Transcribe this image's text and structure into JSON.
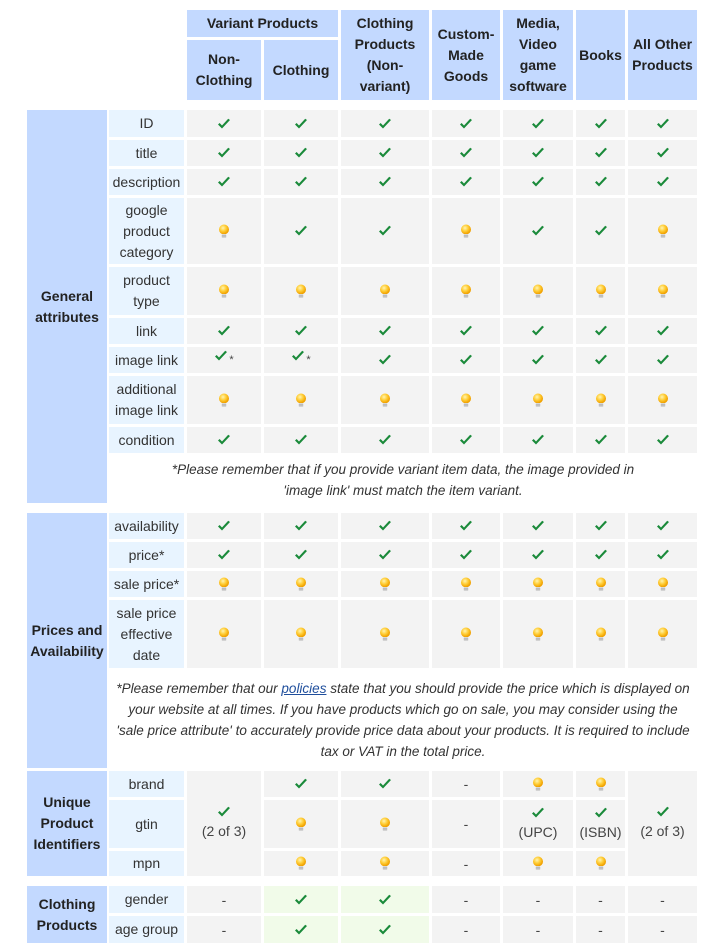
{
  "header": {
    "variant_group": "Variant Products",
    "columns": [
      {
        "key": "non_clothing",
        "label": "Non-\nClothing"
      },
      {
        "key": "clothing",
        "label": "Clothing"
      },
      {
        "key": "clothing_nonvariant",
        "label": "Clothing\nProducts\n(Non-\nvariant)"
      },
      {
        "key": "custom",
        "label": "Custom-\nMade\nGoods"
      },
      {
        "key": "media",
        "label": "Media,\nVideo\ngame\nsoftware"
      },
      {
        "key": "books",
        "label": "Books"
      },
      {
        "key": "other",
        "label": "All Other\nProducts"
      }
    ]
  },
  "legend_icons": {
    "required": "check-icon",
    "recommended": "lightbulb-icon",
    "not_applicable": "-"
  },
  "colors": {
    "header_bg": "#c3d9ff",
    "attr_bg": "#e8f4ff",
    "cell_bg": "#f3f3f3",
    "highlight_bg": "#f1fbe9",
    "check": "#1a8a3a",
    "bulb": "#f5b400",
    "link": "#1f4e9c"
  },
  "sections": [
    {
      "name": "General\nattributes",
      "rows": [
        {
          "attr": "ID",
          "cells": [
            "check",
            "check",
            "check",
            "check",
            "check",
            "check",
            "check"
          ]
        },
        {
          "attr": "title",
          "cells": [
            "check",
            "check",
            "check",
            "check",
            "check",
            "check",
            "check"
          ]
        },
        {
          "attr": "description",
          "cells": [
            "check",
            "check",
            "check",
            "check",
            "check",
            "check",
            "check"
          ]
        },
        {
          "attr": "google\nproduct\ncategory",
          "cells": [
            "bulb",
            "check",
            "check",
            "bulb",
            "check",
            "check",
            "bulb"
          ]
        },
        {
          "attr": "product\ntype",
          "cells": [
            "bulb",
            "bulb",
            "bulb",
            "bulb",
            "bulb",
            "bulb",
            "bulb"
          ]
        },
        {
          "attr": "link",
          "cells": [
            "check",
            "check",
            "check",
            "check",
            "check",
            "check",
            "check"
          ]
        },
        {
          "attr": "image link",
          "cells": [
            "check*",
            "check*",
            "check",
            "check",
            "check",
            "check",
            "check"
          ]
        },
        {
          "attr": "additional\nimage link",
          "cells": [
            "bulb",
            "bulb",
            "bulb",
            "bulb",
            "bulb",
            "bulb",
            "bulb"
          ]
        },
        {
          "attr": "condition",
          "cells": [
            "check",
            "check",
            "check",
            "check",
            "check",
            "check",
            "check"
          ]
        }
      ],
      "note": "*Please remember that if you provide variant item data, the image provided in 'image link' must match the item variant."
    },
    {
      "name": "Prices and\nAvailability",
      "rows": [
        {
          "attr": "availability",
          "cells": [
            "check",
            "check",
            "check",
            "check",
            "check",
            "check",
            "check"
          ]
        },
        {
          "attr": "price*",
          "cells": [
            "check",
            "check",
            "check",
            "check",
            "check",
            "check",
            "check"
          ]
        },
        {
          "attr": "sale price*",
          "cells": [
            "bulb",
            "bulb",
            "bulb",
            "bulb",
            "bulb",
            "bulb",
            "bulb"
          ]
        },
        {
          "attr": "sale price\neffective\ndate",
          "cells": [
            "bulb",
            "bulb",
            "bulb",
            "bulb",
            "bulb",
            "bulb",
            "bulb"
          ]
        }
      ],
      "note_before_link": "*Please remember that our ",
      "note_link": "policies",
      "note_after_link": " state that you should provide the price which is displayed on your website at all times. If you have products which go on sale, you may consider using the 'sale price attribute' to accurately provide price data about your products. It is required to include tax or VAT in the total price."
    },
    {
      "name": "Unique\nProduct\nIdentifiers",
      "rows": [
        {
          "attr": "brand",
          "cells": [
            "check (2 of 3)",
            "check",
            "check",
            "-",
            "bulb",
            "bulb",
            "check (2 of 3)"
          ]
        },
        {
          "attr": "gtin",
          "cells": [
            "",
            "bulb",
            "bulb",
            "-",
            "check (UPC)",
            "check (ISBN)",
            ""
          ]
        },
        {
          "attr": "mpn",
          "cells": [
            "",
            "bulb",
            "bulb",
            "-",
            "bulb",
            "bulb",
            ""
          ]
        }
      ],
      "merged_labels": {
        "non_clothing": "(2 of 3)",
        "other": "(2 of 3)",
        "media_gtin": "(UPC)",
        "books_gtin": "(ISBN)"
      }
    },
    {
      "name": "Clothing\nProducts",
      "rows": [
        {
          "attr": "gender",
          "cells": [
            "-",
            "check",
            "check",
            "-",
            "-",
            "-",
            "-"
          ]
        },
        {
          "attr": "age group",
          "cells": [
            "-",
            "check",
            "check",
            "-",
            "-",
            "-",
            "-"
          ]
        }
      ]
    }
  ]
}
